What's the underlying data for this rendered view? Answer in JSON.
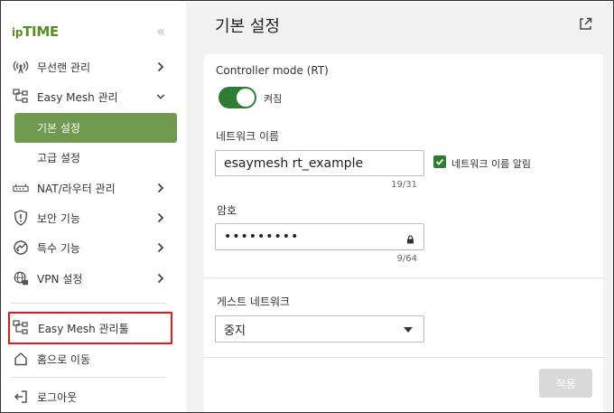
{
  "brand": {
    "logo_prefix": "ip",
    "logo_main": "TIME"
  },
  "sidebar": {
    "collapse_glyph": "«",
    "items": [
      {
        "label": "무선랜 관리",
        "icon": "wireless-icon"
      },
      {
        "label": "Easy Mesh 관리",
        "icon": "mesh-icon"
      },
      {
        "label": "NAT/라우터 관리",
        "icon": "router-icon"
      },
      {
        "label": "보안 기능",
        "icon": "shield-icon"
      },
      {
        "label": "특수 기능",
        "icon": "special-icon"
      },
      {
        "label": "VPN 설정",
        "icon": "vpn-icon"
      }
    ],
    "sub_items": [
      {
        "label": "기본 설정",
        "active": true
      },
      {
        "label": "고급 설정",
        "active": false
      }
    ],
    "bottom_items": [
      {
        "label": "Easy Mesh 관리툴",
        "icon": "mesh-tool-icon"
      },
      {
        "label": "홈으로 이동",
        "icon": "home-icon"
      },
      {
        "label": "로그아웃",
        "icon": "logout-icon"
      }
    ]
  },
  "main": {
    "title": "기본 설정",
    "controller_mode_label": "Controller mode (RT)",
    "controller_mode_state": "켜짐",
    "network_name_label": "네트워크 이름",
    "network_name_value": "esaymesh rt_example",
    "network_name_counter": "19/31",
    "broadcast_label": "네트워크 이름 알림",
    "password_label": "암호",
    "password_value": "•••••••••",
    "password_counter": "9/64",
    "guest_label": "게스트 네트워크",
    "guest_value": "중지",
    "apply_label": "적용"
  },
  "colors": {
    "accent": "#6f9a4f",
    "toggle": "#2e7d32",
    "highlight": "#e01a1a"
  }
}
